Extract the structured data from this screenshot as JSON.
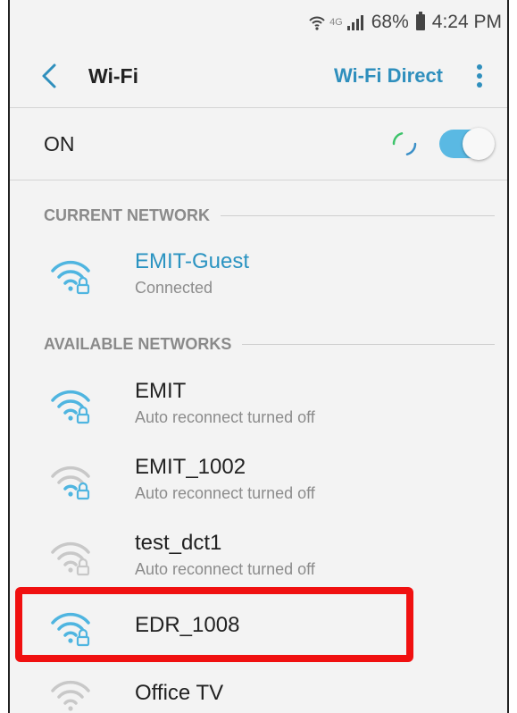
{
  "status_bar": {
    "network_type": "4G",
    "battery": "68%",
    "time": "4:24 PM"
  },
  "header": {
    "title": "Wi-Fi",
    "wifi_direct": "Wi-Fi Direct"
  },
  "toggle": {
    "label": "ON",
    "state": true
  },
  "sections": {
    "current": "CURRENT NETWORK",
    "available": "AVAILABLE NETWORKS"
  },
  "current_network": {
    "name": "EMIT-Guest",
    "status": "Connected",
    "signal": 3
  },
  "available_networks": [
    {
      "name": "EMIT",
      "status": "Auto reconnect turned off",
      "signal": 3
    },
    {
      "name": "EMIT_1002",
      "status": "Auto reconnect turned off",
      "signal": 1
    },
    {
      "name": "test_dct1",
      "status": "Auto reconnect turned off",
      "signal": 0
    },
    {
      "name": "EDR_1008",
      "status": "",
      "signal": 3
    },
    {
      "name": "Office TV",
      "status": "",
      "signal": 0
    }
  ],
  "colors": {
    "accent": "#2a93c1",
    "switch": "#5ab9e3",
    "highlight": "#f01010",
    "wifi_active": "#4fb5e0",
    "wifi_inactive": "#c8c8c8"
  }
}
